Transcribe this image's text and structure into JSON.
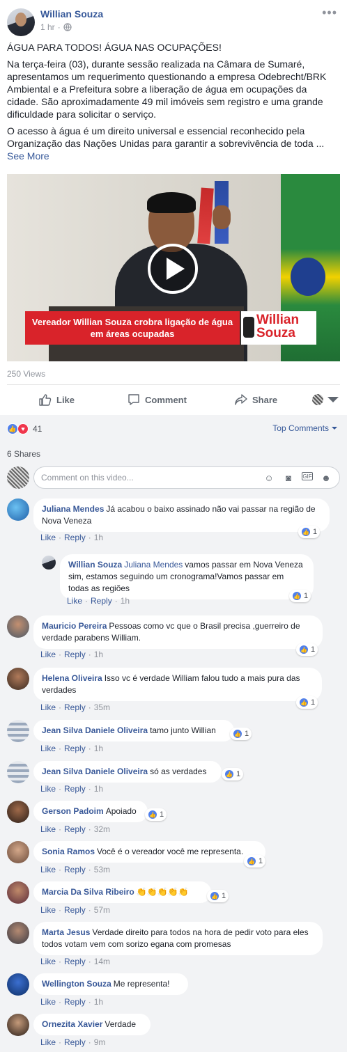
{
  "post": {
    "author": "Willian Souza",
    "time": "1 hr",
    "headline": "ÁGUA PARA TODOS! ÁGUA NAS OCUPAÇÕES!",
    "paragraph1": "Na terça-feira (03), durante sessão realizada na Câmara de Sumaré, apresentamos um requerimento questionando a empresa Odebrecht/BRK Ambiental e a Prefeitura sobre a liberação de água em ocupações da cidade. São aproximadamente 49 mil imóveis sem registro e uma grande dificuldade para solicitar o serviço.",
    "paragraph2": "O acesso à água é um direito universal e essencial reconhecido pela Organização das Nações Unidas para garantir a sobrevivência de toda ...",
    "see_more": "See More",
    "video_banner": "Vereador Willian Souza crobra ligação de água em áreas ocupadas",
    "logo_line1": "Willian",
    "logo_line2": "Souza",
    "views": "250 Views"
  },
  "actions": {
    "like": "Like",
    "comment": "Comment",
    "share": "Share"
  },
  "engagement": {
    "reaction_count": "41",
    "top_comments": "Top Comments",
    "shares": "6 Shares",
    "composer_placeholder": "Comment on this video..."
  },
  "comment_actions": {
    "like": "Like",
    "reply": "Reply"
  },
  "comments": [
    {
      "name": "Juliana Mendes",
      "text": "Já acabou o baixo assinado não vai passar na região de Nova Veneza",
      "time": "1h",
      "likes": "1"
    },
    {
      "name": "Willian Souza",
      "mention": "Juliana Mendes",
      "text": "vamos passar em Nova Veneza sim, estamos seguindo um cronograma!Vamos passar em todas as regiões",
      "time": "1h",
      "likes": "1"
    },
    {
      "name": "Mauricio Pereira",
      "text": "Pessoas como vc que o Brasil precisa ,guerreiro de verdade parabens William.",
      "time": "1h",
      "likes": "1"
    },
    {
      "name": "Helena Oliveira",
      "text": "Isso vc é verdade William falou tudo a mais pura das verdades",
      "time": "35m",
      "likes": "1"
    },
    {
      "name": "Jean Silva Daniele Oliveira",
      "text": "tamo junto Willian",
      "time": "1h",
      "likes": "1"
    },
    {
      "name": "Jean Silva Daniele Oliveira",
      "text": "só as verdades",
      "time": "1h",
      "likes": "1"
    },
    {
      "name": "Gerson Padoim",
      "text": "Apoiado",
      "time": "32m",
      "likes": "1"
    },
    {
      "name": "Sonia Ramos",
      "text": "Você é o vereador você me representa.",
      "time": "53m",
      "likes": "1"
    },
    {
      "name": "Marcia Da Silva Ribeiro",
      "text": "👏👏👏👏👏",
      "time": "57m",
      "likes": "1"
    },
    {
      "name": "Marta Jesus",
      "text": "Verdade direito para todos na hora de pedir voto para eles todos votam vem com sorizo egana com promesas",
      "time": "14m",
      "likes": ""
    },
    {
      "name": "Wellington Souza",
      "text": "Me representa!",
      "time": "1h",
      "likes": ""
    },
    {
      "name": "Ornezita Xavier",
      "text": "Verdade",
      "time": "9m",
      "likes": ""
    }
  ],
  "colors": {
    "link": "#365899",
    "muted": "#90949c",
    "comments_bg": "#f2f3f5",
    "banner_red": "#d9232a"
  }
}
